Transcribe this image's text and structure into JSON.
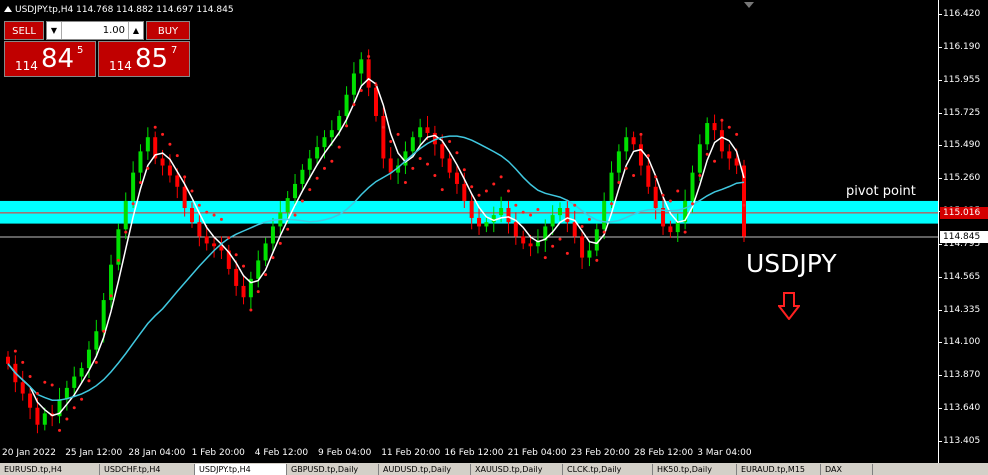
{
  "header": {
    "symbol_line": "USDJPY.tp,H4  114.768 114.882 114.697 114.845"
  },
  "trade_panel": {
    "sell_label": "SELL",
    "buy_label": "BUY",
    "lot_value": "1.00",
    "lot_down_glyph": "▼",
    "lot_up_glyph": "▲",
    "sell_price": {
      "small": "114",
      "big": "84",
      "sup": "5"
    },
    "buy_price": {
      "small": "114",
      "big": "85",
      "sup": "7"
    }
  },
  "price_axis": {
    "ticks": [
      "116.420",
      "116.190",
      "115.955",
      "115.725",
      "115.490",
      "115.260",
      "115.025",
      "114.795",
      "114.565",
      "114.335",
      "114.100",
      "113.870",
      "113.640",
      "113.405"
    ],
    "ask_tag": "115.016",
    "bid_tag": "114.845"
  },
  "time_axis": {
    "ticks": [
      "20 Jan 2022",
      "25 Jan 12:00",
      "28 Jan 04:00",
      "1 Feb 20:00",
      "4 Feb 12:00",
      "9 Feb 04:00",
      "11 Feb 20:00",
      "16 Feb 12:00",
      "21 Feb 04:00",
      "23 Feb 20:00",
      "28 Feb 12:00",
      "3 Mar 04:00"
    ]
  },
  "annotations": {
    "pivot_label": "pivot point",
    "symbol_label": "USDJPY",
    "arrow_color": "#ff2020"
  },
  "colors": {
    "bull_candle": "#00e000",
    "bear_candle": "#ff0000",
    "pivot_band": "#00ffff",
    "fast_ma": "#ffffff",
    "slow_ma": "#40c8e0",
    "sar_dots": "#ff2020"
  },
  "tabs": [
    {
      "label": "EURUSD.tp,H4"
    },
    {
      "label": "USDCHF.tp,H4"
    },
    {
      "label": "USDJPY.tp,H4"
    },
    {
      "label": "GBPUSD.tp,Daily"
    },
    {
      "label": "AUDUSD.tp,Daily"
    },
    {
      "label": "XAUUSD.tp,Daily"
    },
    {
      "label": "CLCK.tp,Daily"
    },
    {
      "label": "HK50.tp,Daily"
    },
    {
      "label": "EURAUD.tp,M15"
    },
    {
      "label": "DAX"
    }
  ],
  "chart_data": {
    "type": "candlestick",
    "symbol": "USDJPY",
    "timeframe": "H4",
    "ylim": [
      113.405,
      116.42
    ],
    "pivot_point": 115.016,
    "pivot_band": [
      114.94,
      115.1
    ],
    "last_price": 114.845,
    "close": [
      113.95,
      113.82,
      113.74,
      113.64,
      113.52,
      113.6,
      113.58,
      113.7,
      113.78,
      113.86,
      113.92,
      114.05,
      114.18,
      114.4,
      114.65,
      114.9,
      115.1,
      115.3,
      115.45,
      115.55,
      115.4,
      115.35,
      115.28,
      115.2,
      115.05,
      114.95,
      114.85,
      114.8,
      114.78,
      114.75,
      114.62,
      114.5,
      114.42,
      114.55,
      114.68,
      114.8,
      114.92,
      115.02,
      115.12,
      115.22,
      115.32,
      115.4,
      115.48,
      115.55,
      115.6,
      115.7,
      115.85,
      116.0,
      116.1,
      115.9,
      115.7,
      115.4,
      115.3,
      115.35,
      115.45,
      115.55,
      115.62,
      115.58,
      115.5,
      115.4,
      115.3,
      115.22,
      115.1,
      114.98,
      114.92,
      114.95,
      115.0,
      115.05,
      114.95,
      114.85,
      114.8,
      114.78,
      114.82,
      114.92,
      115.0,
      115.05,
      114.95,
      114.85,
      114.7,
      114.75,
      114.9,
      115.1,
      115.3,
      115.45,
      115.55,
      115.5,
      115.35,
      115.2,
      115.05,
      114.92,
      114.88,
      114.95,
      115.1,
      115.3,
      115.5,
      115.65,
      115.6,
      115.45,
      115.4,
      115.35,
      114.85
    ]
  }
}
